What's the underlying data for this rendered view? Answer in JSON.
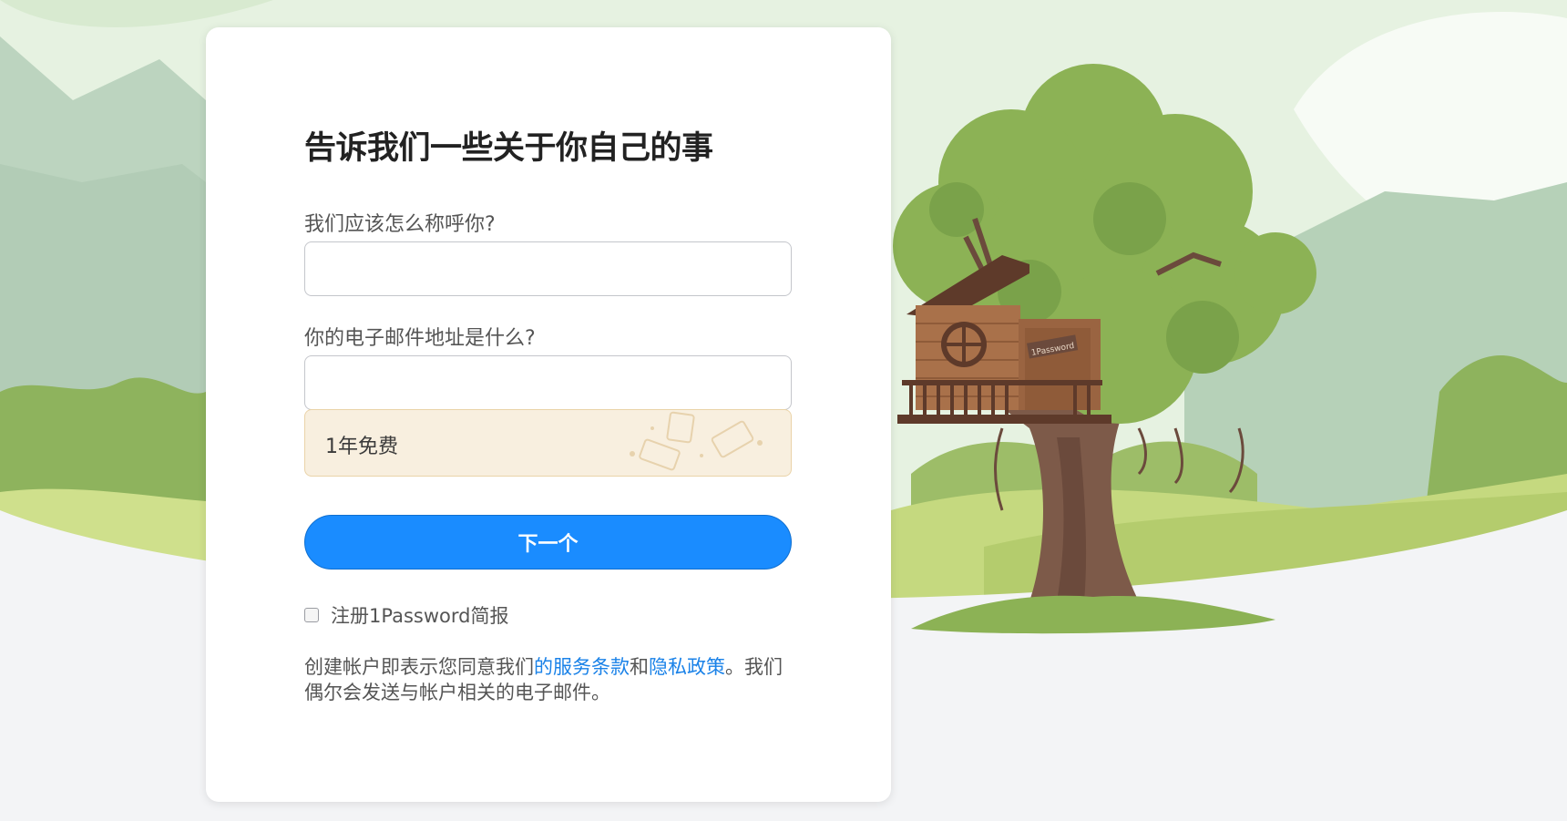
{
  "form": {
    "heading": "告诉我们一些关于你自己的事",
    "name_label": "我们应该怎么称呼你?",
    "name_value": "",
    "email_label": "你的电子邮件地址是什么?",
    "email_value": "",
    "promo_text": "1年免费",
    "next_button": "下一个",
    "newsletter_label": "注册1Password简报",
    "newsletter_checked": false,
    "legal_prefix": "创建帐户即表示您同意我们",
    "terms_link": "的服务条款",
    "legal_and": "和",
    "privacy_link": "隐私政策",
    "legal_suffix": "。我们偶尔会发送与帐户相关的电子邮件。"
  },
  "illustration": {
    "sign_text": "1Password"
  },
  "colors": {
    "accent": "#1a8cff",
    "link": "#1a82e8",
    "promo_bg": "#f8efdf",
    "sky": "#e6f2e1",
    "hills": "#a9c57a",
    "foliage": "#8cb255",
    "house": "#a9714a",
    "trunk": "#7d5a49"
  }
}
